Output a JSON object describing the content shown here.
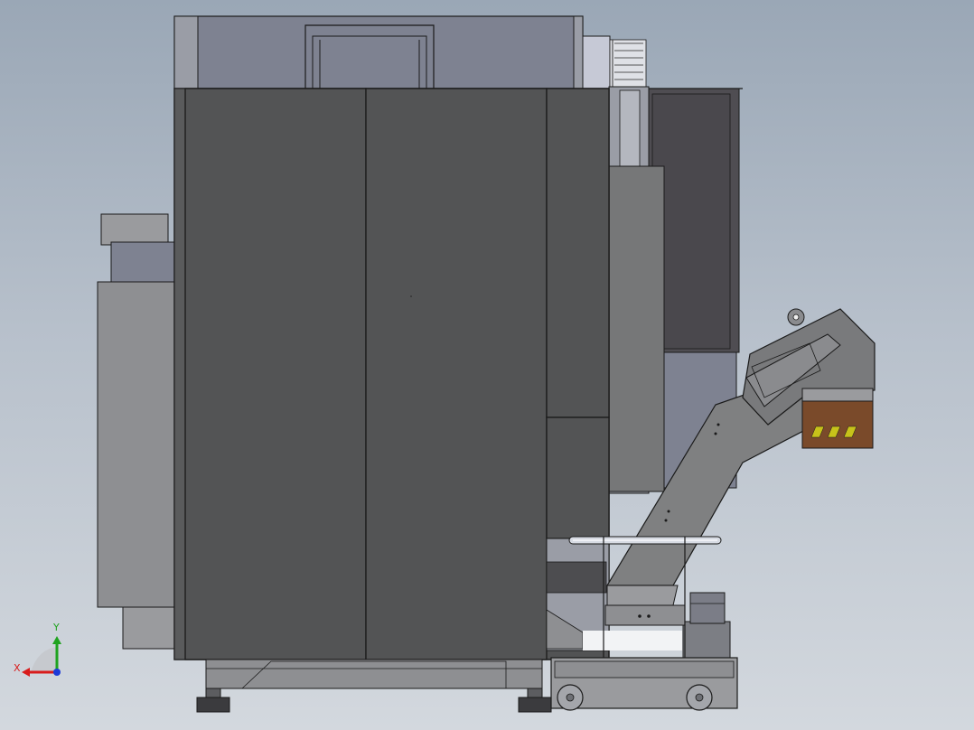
{
  "viewport": {
    "background_top": "#9aa7b6",
    "background_bottom": "#d3d8de"
  },
  "model": {
    "door_color": "#525354",
    "panel_color": "#6f7073",
    "frame_color": "#7f838e",
    "edge_color": "#1a1a1a",
    "chip_bin_color": "#7a4a2a",
    "chip_bin_label_color": "#c7c21a"
  },
  "triad": {
    "x_label": "X",
    "y_label": "Y",
    "x_color": "#d81c1c",
    "y_color": "#1fa31f",
    "z_color": "#1c3ad8"
  }
}
